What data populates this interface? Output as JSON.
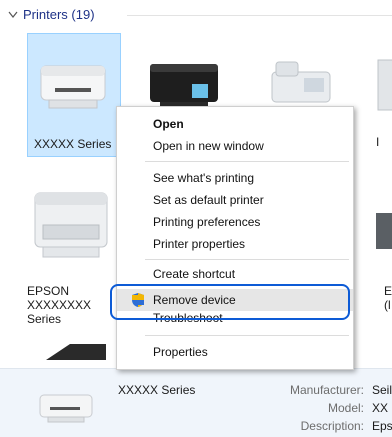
{
  "group": {
    "title": "Printers (19)"
  },
  "tiles": {
    "t1": "XXXXX Series",
    "t2_partial": ")",
    "t3_partial": "I",
    "epson_line1": "EPSON",
    "epson_line2": "XXXXXXXX",
    "epson_line3": "Series",
    "right_e": "E",
    "right_l": "(l"
  },
  "context_menu": {
    "open": "Open",
    "open_new_window": "Open in new window",
    "see_printing": "See what's printing",
    "set_default": "Set as default printer",
    "printing_prefs": "Printing preferences",
    "printer_props": "Printer properties",
    "create_shortcut": "Create shortcut",
    "remove_device": "Remove device",
    "troubleshoot": "Troubleshoot",
    "properties": "Properties"
  },
  "details": {
    "name": "XXXXX Series",
    "manufacturer_label": "Manufacturer:",
    "manufacturer_value": "Seil",
    "model_label": "Model:",
    "model_value": "XX",
    "description_label": "Description:",
    "description_value": "Eps"
  },
  "colors": {
    "accent": "#0d5bd6",
    "selection": "#cce8ff",
    "title": "#1e3287"
  }
}
